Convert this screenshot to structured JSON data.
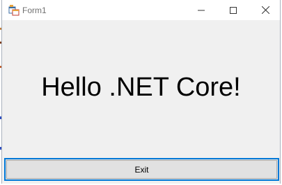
{
  "window": {
    "title": "Form1",
    "icon": "winforms-app-icon"
  },
  "caption_buttons": {
    "minimize_icon": "minimize-icon",
    "maximize_icon": "maximize-icon",
    "close_icon": "close-icon"
  },
  "content": {
    "greeting": "Hello .NET Core!"
  },
  "exit_button": {
    "label": "Exit"
  },
  "colors": {
    "client_background": "#f0f0f0",
    "titlebar_background": "#ffffff",
    "focus_border": "#0078d7",
    "button_face": "#e1e1e1"
  }
}
